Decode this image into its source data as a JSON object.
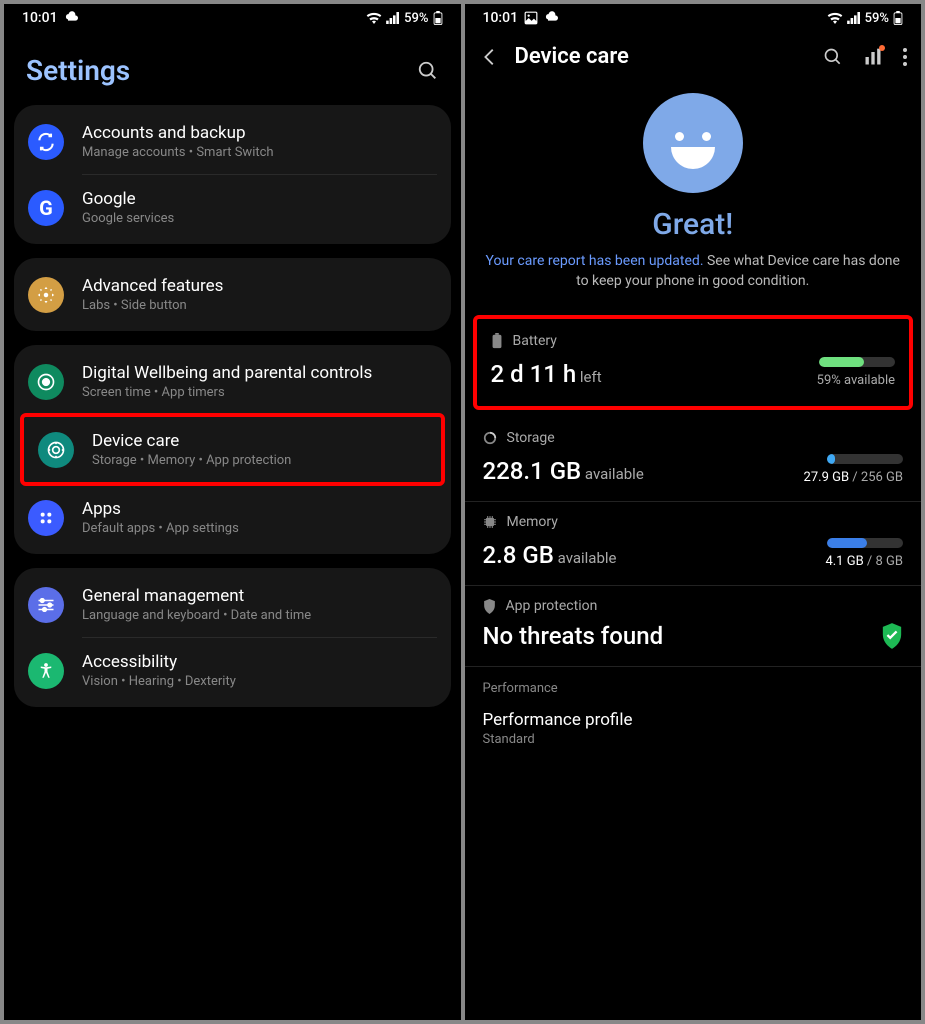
{
  "status": {
    "time": "10:01",
    "battery": "59%"
  },
  "left": {
    "title": "Settings",
    "groups": [
      {
        "items": [
          {
            "title": "Accounts and backup",
            "sub": "Manage accounts • Smart Switch",
            "iconBg": "#2B5BFF"
          },
          {
            "title": "Google",
            "sub": "Google services",
            "iconBg": "#2B5BFF"
          }
        ]
      },
      {
        "items": [
          {
            "title": "Advanced features",
            "sub": "Labs • Side button",
            "iconBg": "#D39E44"
          }
        ]
      },
      {
        "items": [
          {
            "title": "Digital Wellbeing and parental controls",
            "sub": "Screen time • App timers",
            "iconBg": "#0F8A5F"
          },
          {
            "title": "Device care",
            "sub": "Storage • Memory • App protection",
            "iconBg": "#0F8A7E",
            "hl": true
          },
          {
            "title": "Apps",
            "sub": "Default apps • App settings",
            "iconBg": "#3B5BFF"
          }
        ]
      },
      {
        "items": [
          {
            "title": "General management",
            "sub": "Language and keyboard • Date and time",
            "iconBg": "#5B6EE8"
          },
          {
            "title": "Accessibility",
            "sub": "Vision • Hearing • Dexterity",
            "iconBg": "#1BB871"
          }
        ]
      }
    ]
  },
  "right": {
    "title": "Device care",
    "statusWord": "Great!",
    "careLink": "Your care report has been updated.",
    "careText": " See what Device care has done to keep your phone in good condition.",
    "battery": {
      "label": "Battery",
      "big": "2 d 11 h",
      "bigSub": " left",
      "right": "59% available",
      "fill": 59,
      "color": "#6FE07F",
      "hl": true
    },
    "storage": {
      "label": "Storage",
      "big": "228.1 GB",
      "bigSub": " available",
      "used": "27.9 GB",
      "total": " / 256 GB",
      "fill": 11,
      "color": "#3FA9F5"
    },
    "memory": {
      "label": "Memory",
      "big": "2.8 GB",
      "bigSub": " available",
      "used": "4.1 GB",
      "total": " / 8 GB",
      "fill": 52,
      "color": "#3B7FE8"
    },
    "appProtection": {
      "label": "App protection",
      "status": "No threats found"
    },
    "perf": {
      "header": "Performance",
      "title": "Performance profile",
      "sub": "Standard"
    }
  }
}
